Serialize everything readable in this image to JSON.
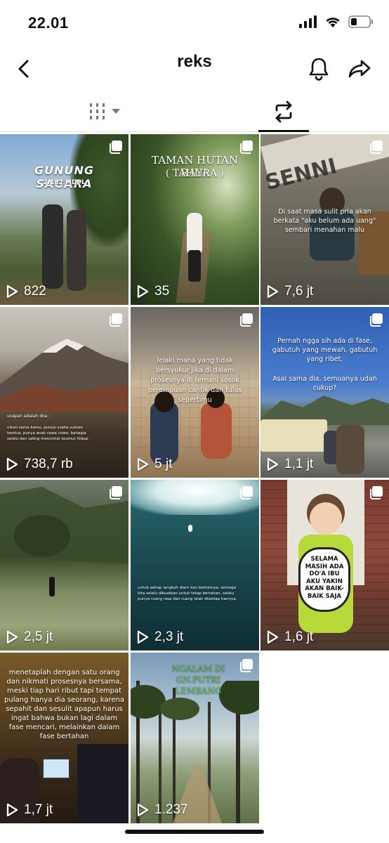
{
  "status": {
    "time": "22.01"
  },
  "header": {
    "title": "reks"
  },
  "tabs": [
    {
      "name": "videos",
      "active": false
    },
    {
      "name": "reposts",
      "active": true
    }
  ],
  "grid": [
    {
      "views": "822",
      "caption": "GUNUNG SAGARA",
      "sub": "2.182 MDPL"
    },
    {
      "views": "35",
      "caption": "TAMAN HUTAN RAYA",
      "sub": "( TAHURA )"
    },
    {
      "views": "7,6 jt",
      "caption": "Di saat masa sulit pria akan berkata \"aku belum ada uang\" sembari menahan malu",
      "sub": "SENNI"
    },
    {
      "views": "738,7 rb",
      "caption": "ucapan adalah doa :",
      "sub": "nikah sama kamu, punya usaha sukses berdua, punya anak cewe cowo, bahagia selalu dan saling mencintai seumur hidup."
    },
    {
      "views": "5 jt",
      "caption": "lelaki mana yang tidak bersyukur jika di dalam prosesnya di temani sosok perempuan cantik dan tulus sepertimu",
      "sub": ""
    },
    {
      "views": "1,1 jt",
      "caption": "Pernah ngga sih ada di fase, gabutuh yang mewah, gabutuh yang ribet.",
      "sub": "Asal sama dia, semuanya udah cukup?"
    },
    {
      "views": "2,5 jt",
      "caption": "",
      "sub": ""
    },
    {
      "views": "2,3 jt",
      "caption": "untuk setiap langkah diam kan berkatnya, semoga kita selalu dikuatkan untuk tetap bertahan, selalu punya ruang rasa dan ruang lelah disetiap harinya.",
      "sub": ""
    },
    {
      "views": "1,6 jt",
      "caption": "SELAMA MASIH ADA DO'A IBU AKU YAKIN AKAN BAIK-BAIK SAJA",
      "sub": ""
    },
    {
      "views": "1,7 jt",
      "caption": "menetaplah dengan satu orang dan nikmati prosesnya bersama, meski tiap hari ribut tapi tempat pulang hanya dia seorang, karena sepahit dan sesulit apapun harus ingat bahwa bukan lagi dalam fase mencari, melainkan dalam fase bertahan",
      "sub": ""
    },
    {
      "views": "1.237",
      "caption": "NGALAM DI GN.PUTRI LEMBANG",
      "sub": ""
    }
  ],
  "colors": {
    "accent": "#111111",
    "tab_divider": "#e3e3e3"
  },
  "icons": [
    "back-arrow-icon",
    "bell-icon",
    "share-icon",
    "videos-grid-icon",
    "repost-icon",
    "play-icon",
    "multi-photo-icon"
  ]
}
